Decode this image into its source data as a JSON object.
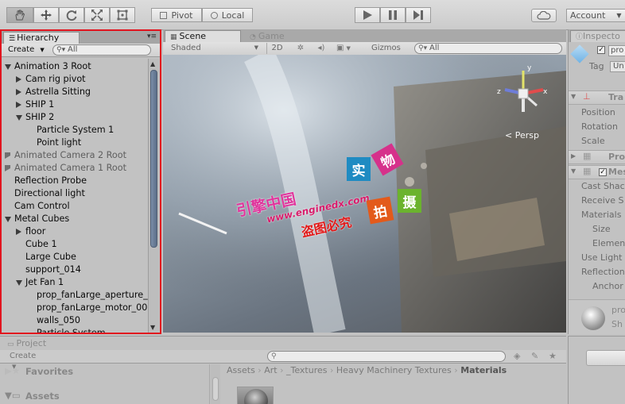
{
  "toolbar": {
    "pivot_label": "Pivot",
    "local_label": "Local",
    "account_label": "Account"
  },
  "hierarchy": {
    "tab_label": "Hierarchy",
    "create_label": "Create",
    "search_placeholder": "All",
    "items": [
      {
        "label": "Animation 3 Root",
        "depth": 0,
        "expander": "down",
        "dim": false
      },
      {
        "label": "Cam rig pivot",
        "depth": 1,
        "expander": "right",
        "dim": false
      },
      {
        "label": "Astrella Sitting",
        "depth": 1,
        "expander": "right",
        "dim": false
      },
      {
        "label": "SHIP 1",
        "depth": 1,
        "expander": "right",
        "dim": false
      },
      {
        "label": "SHIP 2",
        "depth": 1,
        "expander": "down",
        "dim": false
      },
      {
        "label": "Particle System 1",
        "depth": 2,
        "expander": "none",
        "dim": false
      },
      {
        "label": "Point light",
        "depth": 2,
        "expander": "none",
        "dim": false
      },
      {
        "label": "Animated Camera 2 Root",
        "depth": 0,
        "expander": "right",
        "dim": true
      },
      {
        "label": "Animated Camera 1 Root",
        "depth": 0,
        "expander": "right",
        "dim": true
      },
      {
        "label": "Reflection Probe",
        "depth": 0,
        "expander": "none",
        "dim": false
      },
      {
        "label": "Directional light",
        "depth": 0,
        "expander": "none",
        "dim": false
      },
      {
        "label": "Cam Control",
        "depth": 0,
        "expander": "none",
        "dim": false
      },
      {
        "label": "Metal Cubes",
        "depth": 0,
        "expander": "down",
        "dim": false
      },
      {
        "label": "floor",
        "depth": 1,
        "expander": "right",
        "dim": false
      },
      {
        "label": "Cube 1",
        "depth": 1,
        "expander": "none",
        "dim": false
      },
      {
        "label": "Large Cube",
        "depth": 1,
        "expander": "none",
        "dim": false
      },
      {
        "label": "support_014",
        "depth": 1,
        "expander": "none",
        "dim": false
      },
      {
        "label": "Jet Fan 1",
        "depth": 1,
        "expander": "down",
        "dim": false
      },
      {
        "label": "prop_fanLarge_aperture_",
        "depth": 2,
        "expander": "none",
        "dim": false
      },
      {
        "label": "prop_fanLarge_motor_00",
        "depth": 2,
        "expander": "none",
        "dim": false
      },
      {
        "label": "walls_050",
        "depth": 2,
        "expander": "none",
        "dim": false
      },
      {
        "label": "Particle System",
        "depth": 2,
        "expander": "none",
        "dim": false
      }
    ]
  },
  "scene": {
    "tab_scene": "Scene",
    "tab_game": "Game",
    "shading_mode": "Shaded",
    "mode_2d": "2D",
    "gizmos_label": "Gizmos",
    "search_placeholder": "All",
    "persp_label": "Persp",
    "gizmo_axes": {
      "x": "x",
      "y": "y",
      "z": "z"
    }
  },
  "inspector": {
    "tab_label": "Inspecto",
    "name_value": "pro",
    "tag_label": "Tag",
    "tag_value": "Un",
    "transform_header": "Tra",
    "rows_transform": [
      "Position",
      "Rotation",
      "Scale"
    ],
    "component_header_1": "Pro",
    "component_header_2": "Mes",
    "rows_mesh": [
      "Cast Shac",
      "Receive S",
      "Materials",
      "Size",
      "Elemen",
      "Use Light",
      "Reflection",
      "Anchor"
    ],
    "material_name": "pro",
    "material_shader": "Sh"
  },
  "project": {
    "tab_label": "Project",
    "create_label": "Create",
    "favorites_label": "Favorites",
    "assets_label": "Assets",
    "breadcrumb": [
      "Assets",
      "Art",
      "_Textures",
      "Heavy Machinery Textures",
      "Materials"
    ]
  },
  "watermark": {
    "line_cn": "引擎中国",
    "url": "www.enginedx.com",
    "warning": "盗图必究",
    "boxes": [
      {
        "char": "实",
        "color": "#1f8bc2"
      },
      {
        "char": "物",
        "color": "#d6318b"
      },
      {
        "char": "拍",
        "color": "#e35a1b"
      },
      {
        "char": "摄",
        "color": "#6bb32e"
      }
    ]
  }
}
